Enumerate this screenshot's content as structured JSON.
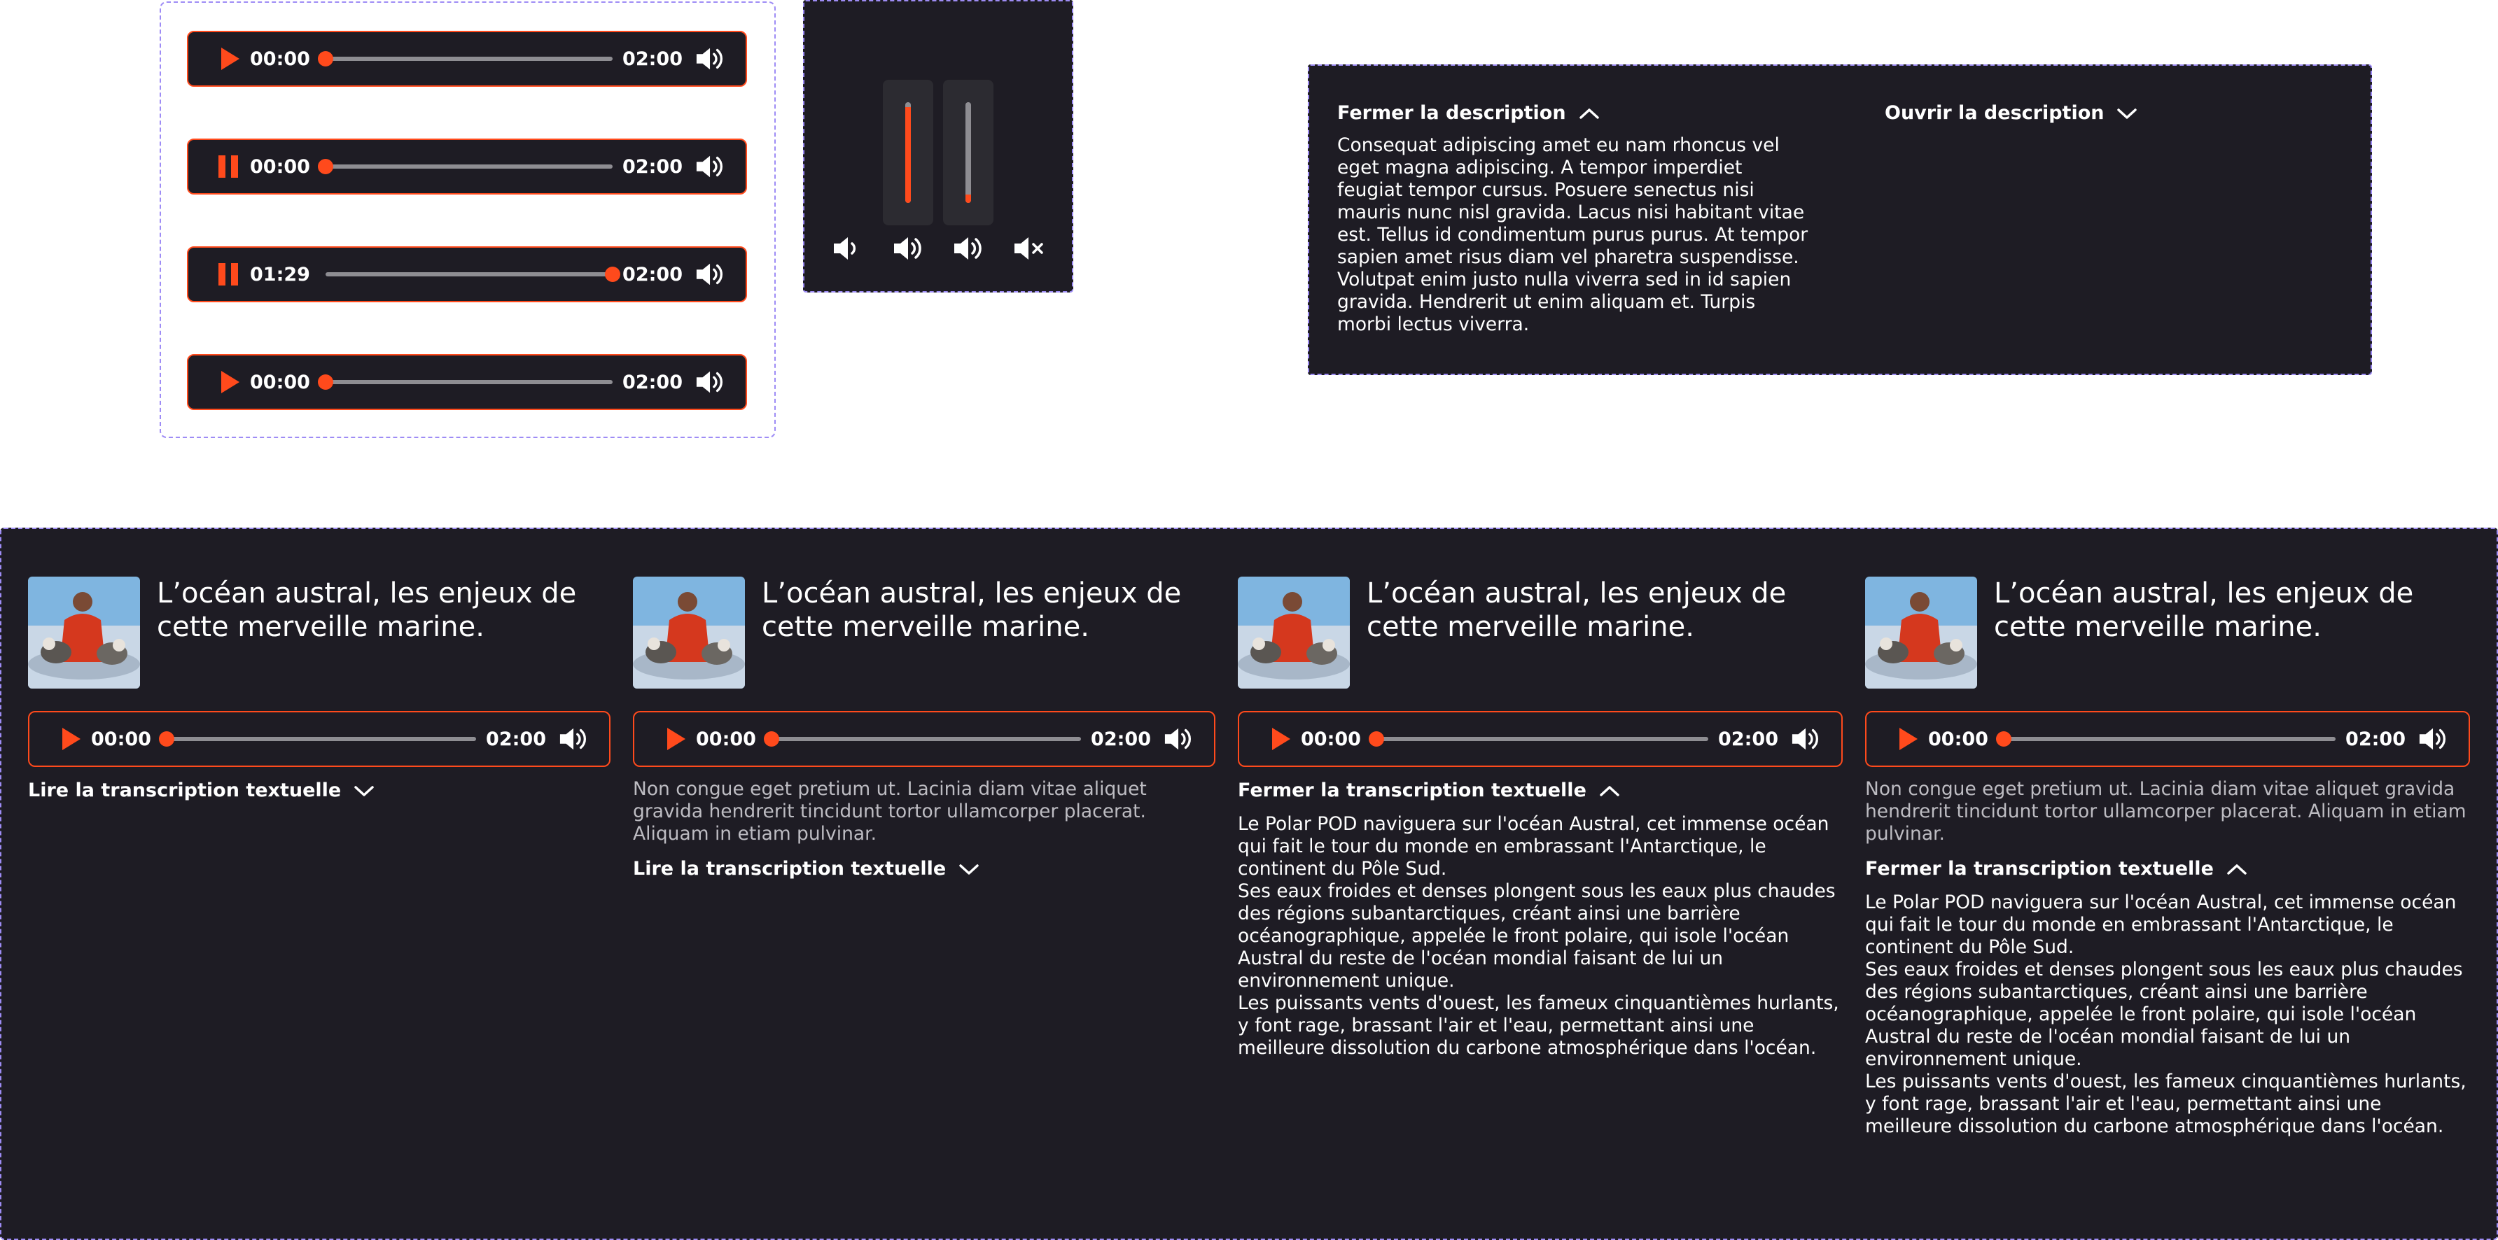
{
  "players_group": [
    {
      "state": "play",
      "current": "00:00",
      "duration": "02:00",
      "progress": 0
    },
    {
      "state": "pause",
      "current": "00:00",
      "duration": "02:00",
      "progress": 0
    },
    {
      "state": "pause",
      "current": "01:29",
      "duration": "02:00",
      "progress": 1
    },
    {
      "state": "play",
      "current": "00:00",
      "duration": "02:00",
      "progress": 0
    }
  ],
  "volume_panel": {
    "sliders": [
      {
        "level": 0.95
      },
      {
        "level": 0.08
      }
    ],
    "icons": [
      "volume-low-icon",
      "volume-medium-icon",
      "volume-high-icon",
      "volume-mute-icon"
    ]
  },
  "description": {
    "close_label": "Fermer la description",
    "open_label": "Ouvrir la description",
    "text": "Consequat adipiscing amet eu nam rhoncus vel eget magna adipiscing. A tempor imperdiet feugiat tempor cursus. Posuere senectus nisi mauris nunc nisl gravida. Lacus nisi habitant vitae est. Tellus id condimentum purus purus. At tempor sapien amet risus diam vel pharetra suspendisse. Volutpat enim justo nulla viverra sed in id sapien gravida. Hendrerit ut enim aliquam et. Turpis morbi lectus viverra."
  },
  "cards": [
    {
      "title": "L’océan austral, les enjeux de cette merveille marine.",
      "player": {
        "state": "play",
        "current": "00:00",
        "duration": "02:00",
        "progress": 0
      },
      "intro": "",
      "toggle_label": "Lire la transcription textuelle",
      "expanded": false,
      "transcript": ""
    },
    {
      "title": "L’océan austral, les enjeux de cette merveille marine.",
      "player": {
        "state": "play",
        "current": "00:00",
        "duration": "02:00",
        "progress": 0
      },
      "intro": "Non congue eget pretium ut. Lacinia diam vitae aliquet gravida hendrerit tincidunt tortor ullamcorper placerat. Aliquam in etiam pulvinar.",
      "toggle_label": "Lire la transcription textuelle",
      "expanded": false,
      "transcript": ""
    },
    {
      "title": "L’océan austral, les enjeux de cette merveille marine.",
      "player": {
        "state": "play",
        "current": "00:00",
        "duration": "02:00",
        "progress": 0
      },
      "intro": "",
      "toggle_label": "Fermer la transcription textuelle",
      "expanded": true,
      "transcript": "Le Polar POD naviguera sur l'océan Austral, cet immense océan qui fait le tour du monde en embrassant l'Antarctique, le continent du Pôle Sud.\nSes eaux froides et denses plongent sous les eaux plus chaudes des régions subantarctiques, créant ainsi une barrière océanographique, appelée le front polaire, qui isole l'océan Austral du reste de l'océan mondial faisant de lui un environnement unique.\nLes puissants vents d'ouest, les fameux cinquantièmes hurlants, y font rage, brassant l'air et l'eau, permettant ainsi une meilleure dissolution du carbone atmosphérique dans l'océan."
    },
    {
      "title": "L’océan austral, les enjeux de cette merveille marine.",
      "player": {
        "state": "play",
        "current": "00:00",
        "duration": "02:00",
        "progress": 0
      },
      "intro": "Non congue eget pretium ut. Lacinia diam vitae aliquet gravida hendrerit tincidunt tortor ullamcorper placerat. Aliquam in etiam pulvinar.",
      "toggle_label": "Fermer la transcription textuelle",
      "expanded": true,
      "transcript": "Le Polar POD naviguera sur l'océan Austral, cet immense océan qui fait le tour du monde en embrassant l'Antarctique, le continent du Pôle Sud.\nSes eaux froides et denses plongent sous les eaux plus chaudes des régions subantarctiques, créant ainsi une barrière océanographique, appelée le front polaire, qui isole l'océan Austral du reste de l'océan mondial faisant de lui un environnement unique.\nLes puissants vents d'ouest, les fameux cinquantièmes hurlants, y font rage, brassant l'air et l'eau, permettant ainsi une meilleure dissolution du carbone atmosphérique dans l'océan."
    }
  ],
  "colors": {
    "accent": "#ff4a1c",
    "panel": "#1e1c24",
    "track": "#8e8d92",
    "frame": "#9e8cf5"
  }
}
